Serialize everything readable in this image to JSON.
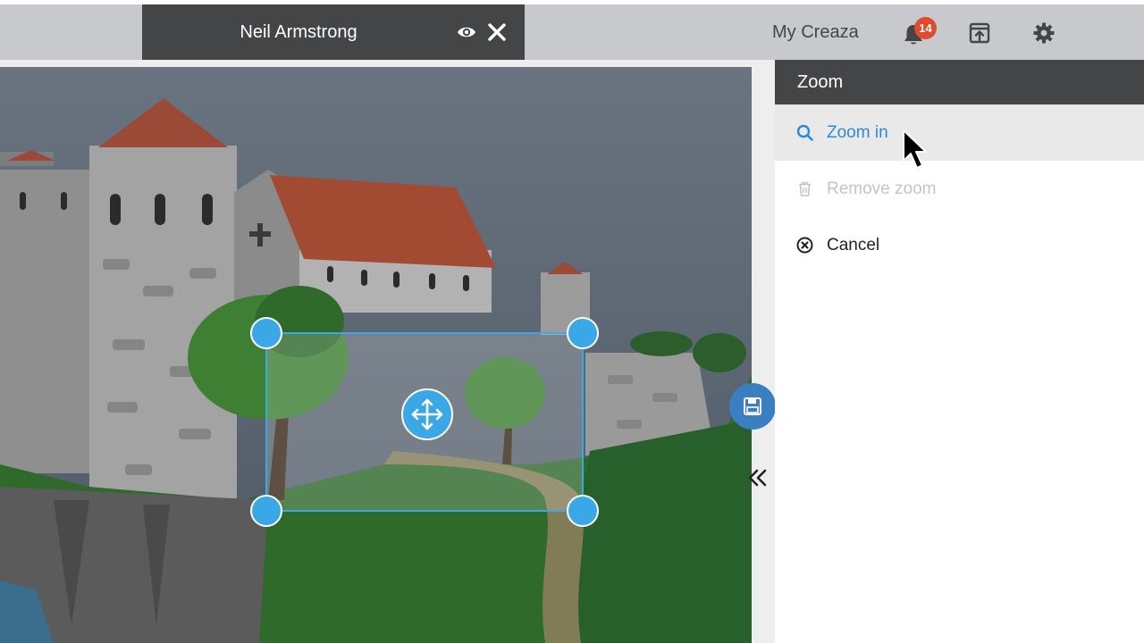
{
  "header": {
    "document_title": "Neil Armstrong",
    "my_creaza_label": "My Creaza",
    "notification_count": "14",
    "icons": [
      "eye-icon",
      "close-icon",
      "bell-icon",
      "share-icon",
      "gear-icon"
    ]
  },
  "canvas": {
    "tools": [
      "save-icon",
      "move-icon",
      "double-chevron-left-icon"
    ]
  },
  "panel": {
    "title": "Zoom",
    "items": [
      {
        "label": "Zoom in",
        "icon": "search-icon",
        "state": "hover"
      },
      {
        "label": "Remove zoom",
        "icon": "trash-icon",
        "state": "disabled"
      },
      {
        "label": "Cancel",
        "icon": "cancel-circle-icon",
        "state": "normal"
      }
    ]
  },
  "colors": {
    "accent": "#2d8ad0",
    "handle": "#3aa7e6",
    "header_dark": "#444547",
    "badge": "#e04a2f",
    "topbar": "#c8c9cc"
  }
}
